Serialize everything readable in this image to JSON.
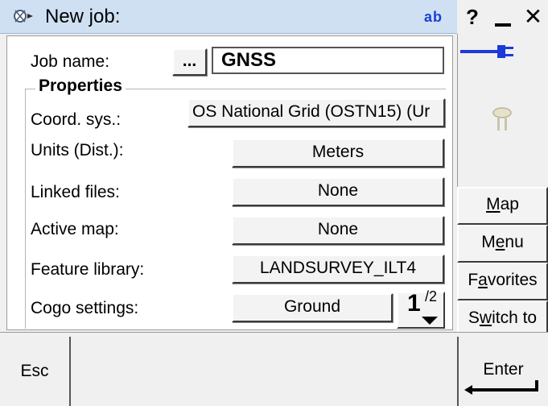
{
  "titlebar": {
    "title": "New job:",
    "input_mode": "ab",
    "help_label": "?",
    "close_label": "✕",
    "icon": "satellite-icon"
  },
  "form": {
    "job_name_label": "Job name:",
    "browse_label": "...",
    "job_name_value": "GNSS",
    "properties_title": "Properties",
    "rows": [
      {
        "label": "Coord. sys.:",
        "value": "OS National Grid (OSTN15) (Ur"
      },
      {
        "label": "Units (Dist.):",
        "value": "Meters"
      },
      {
        "label": "Linked files:",
        "value": "None"
      },
      {
        "label": "Active map:",
        "value": "None"
      },
      {
        "label": "Feature library:",
        "value": "LANDSURVEY_ILT4"
      },
      {
        "label": "Cogo settings:",
        "value": "Ground"
      }
    ],
    "page_current": "1",
    "page_total": "/2"
  },
  "status": {
    "connection_icon": "cable-connection-icon",
    "receiver_icon": "gnss-receiver-icon"
  },
  "side_buttons": {
    "map": {
      "pre": "",
      "u": "M",
      "post": "ap"
    },
    "menu": {
      "pre": "M",
      "u": "e",
      "post": "nu"
    },
    "favorites": {
      "pre": "F",
      "u": "a",
      "post": "vorites"
    },
    "switch_to": {
      "pre": "S",
      "u": "w",
      "post": "itch to"
    }
  },
  "bottom": {
    "esc_label": "Esc",
    "enter_label": "Enter"
  }
}
